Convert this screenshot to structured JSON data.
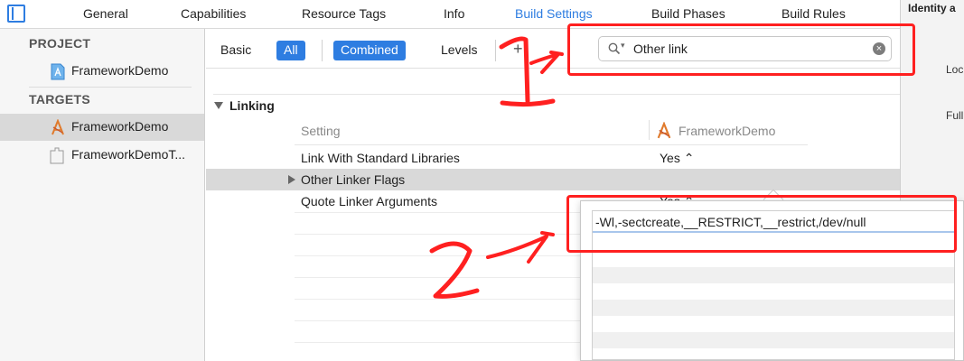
{
  "tabs": [
    {
      "label": "General",
      "active": false
    },
    {
      "label": "Capabilities",
      "active": false
    },
    {
      "label": "Resource Tags",
      "active": false
    },
    {
      "label": "Info",
      "active": false
    },
    {
      "label": "Build Settings",
      "active": true
    },
    {
      "label": "Build Phases",
      "active": false
    },
    {
      "label": "Build Rules",
      "active": false
    }
  ],
  "navigator": {
    "project_header": "PROJECT",
    "project_item": "FrameworkDemo",
    "targets_header": "TARGETS",
    "targets": [
      {
        "label": "FrameworkDemo",
        "selected": true,
        "icon": "app-target-icon"
      },
      {
        "label": "FrameworkDemoT...",
        "selected": false,
        "icon": "test-bundle-icon"
      }
    ]
  },
  "filter": {
    "basic": "Basic",
    "all": "All",
    "combined": "Combined",
    "levels": "Levels",
    "plus": "+",
    "search_value": "Other link"
  },
  "inspector": {
    "title": "Identity a",
    "label_1": "Loc",
    "label_2": "Full"
  },
  "section": {
    "title": "Linking",
    "col_setting": "Setting",
    "col_target": "FrameworkDemo",
    "rows": [
      {
        "name": "Link With Standard Libraries",
        "value": "Yes ⌃"
      },
      {
        "name": "Other Linker Flags",
        "value": ""
      },
      {
        "name": "Quote Linker Arguments",
        "value": "Yes ⌃"
      }
    ]
  },
  "popover": {
    "entry": "-Wl,-sectcreate,__RESTRICT,__restrict,/dev/null"
  },
  "colors": {
    "accent": "#2e7de1",
    "annotation": "#ff2020",
    "selection": "#d9d9d9"
  }
}
